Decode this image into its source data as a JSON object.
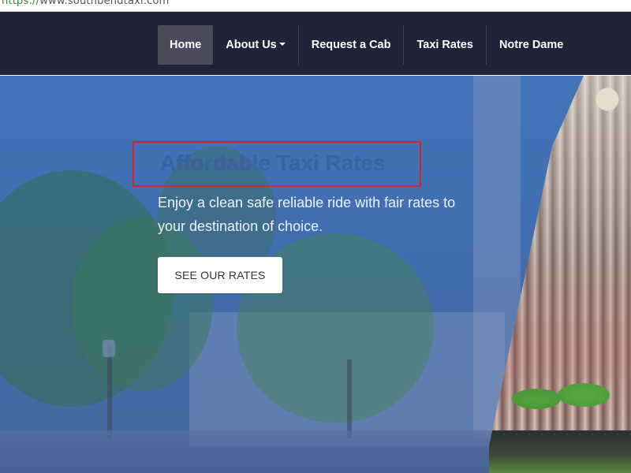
{
  "browser": {
    "url_scheme": "https://",
    "url_host": "www.southbendtaxi.com"
  },
  "navbar": {
    "items": [
      {
        "label": "Home",
        "active": true
      },
      {
        "label": "About Us",
        "has_dropdown": true
      },
      {
        "label": "Request a Cab"
      },
      {
        "label": "Taxi Rates"
      },
      {
        "label": "Notre Dame"
      }
    ]
  },
  "hero": {
    "title": "Affordable Taxi Rates",
    "subtitle": "Enjoy a clean safe reliable ride with fair rates to your destination of choice.",
    "cta_label": "SEE OUR RATES"
  },
  "colors": {
    "navbar_bg": "#222239",
    "active_item_bg": "#4a4a5a",
    "hero_overlay": "#3d6db0",
    "highlight_box": "#d6202c"
  }
}
